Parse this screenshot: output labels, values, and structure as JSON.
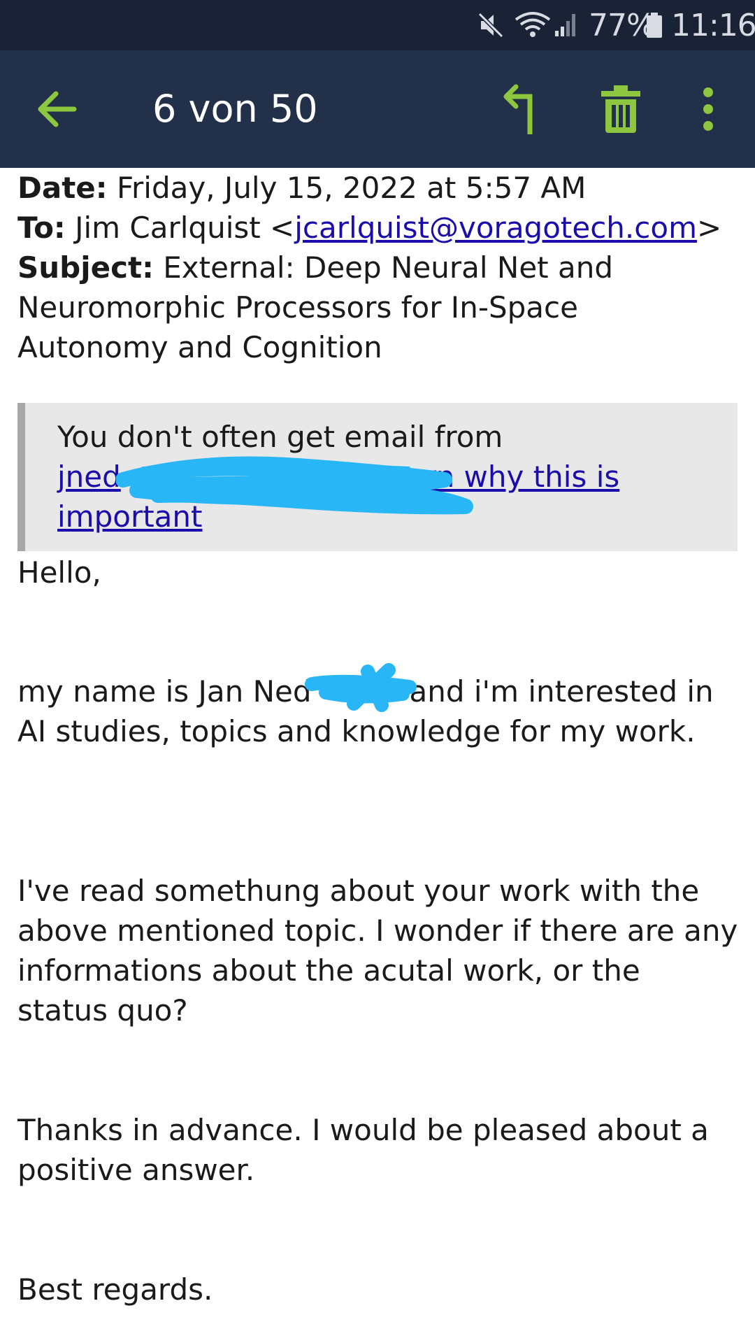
{
  "status_bar": {
    "battery": "77%",
    "time": "11:16",
    "icons": [
      "mute-icon",
      "wifi-icon",
      "signal-icon",
      "battery-icon"
    ]
  },
  "app_bar": {
    "title": "6 von 50",
    "accent_color": "#8dc63f",
    "icons": [
      "back-arrow-icon",
      "reply-icon",
      "trash-icon",
      "more-vert-icon"
    ]
  },
  "email_header": {
    "date_label": "Date:",
    "date_value": "Friday, July 15, 2022 at 5:57 AM",
    "to_label": "To:",
    "to_name": "Jim Carlquist <",
    "to_email": "jcarlquist@voragotech.com",
    "to_close": ">",
    "subject_label": "Subject:",
    "subject_line1": "External: Deep Neural Net and",
    "subject_line2": "Neuromorphic Processors for In-Space",
    "subject_line3": "Autonomy and Cognition"
  },
  "notice": {
    "line1": "You don't often get email from",
    "sender_visible": "jned",
    "learn_why_line1": "Learn why this is",
    "learn_why_line2": "important"
  },
  "body": {
    "greeting": "Hello,",
    "p1_part1": "my name is Jan Ned",
    "p1_part2": "and i'm interested in",
    "p1_line2": "AI studies, topics and knowledge for my work.",
    "p2_line1": "I've read somethung about your work with the",
    "p2_line2": "above mentioned topic. I wonder if there are any",
    "p2_line3": "informations about the acutal work, or the",
    "p2_line4": "status quo?",
    "p3_line1": "Thanks in advance. I would be pleased about a",
    "p3_line2": "positive answer.",
    "closing": "Best regards."
  },
  "redaction_color": "#29b6f6"
}
